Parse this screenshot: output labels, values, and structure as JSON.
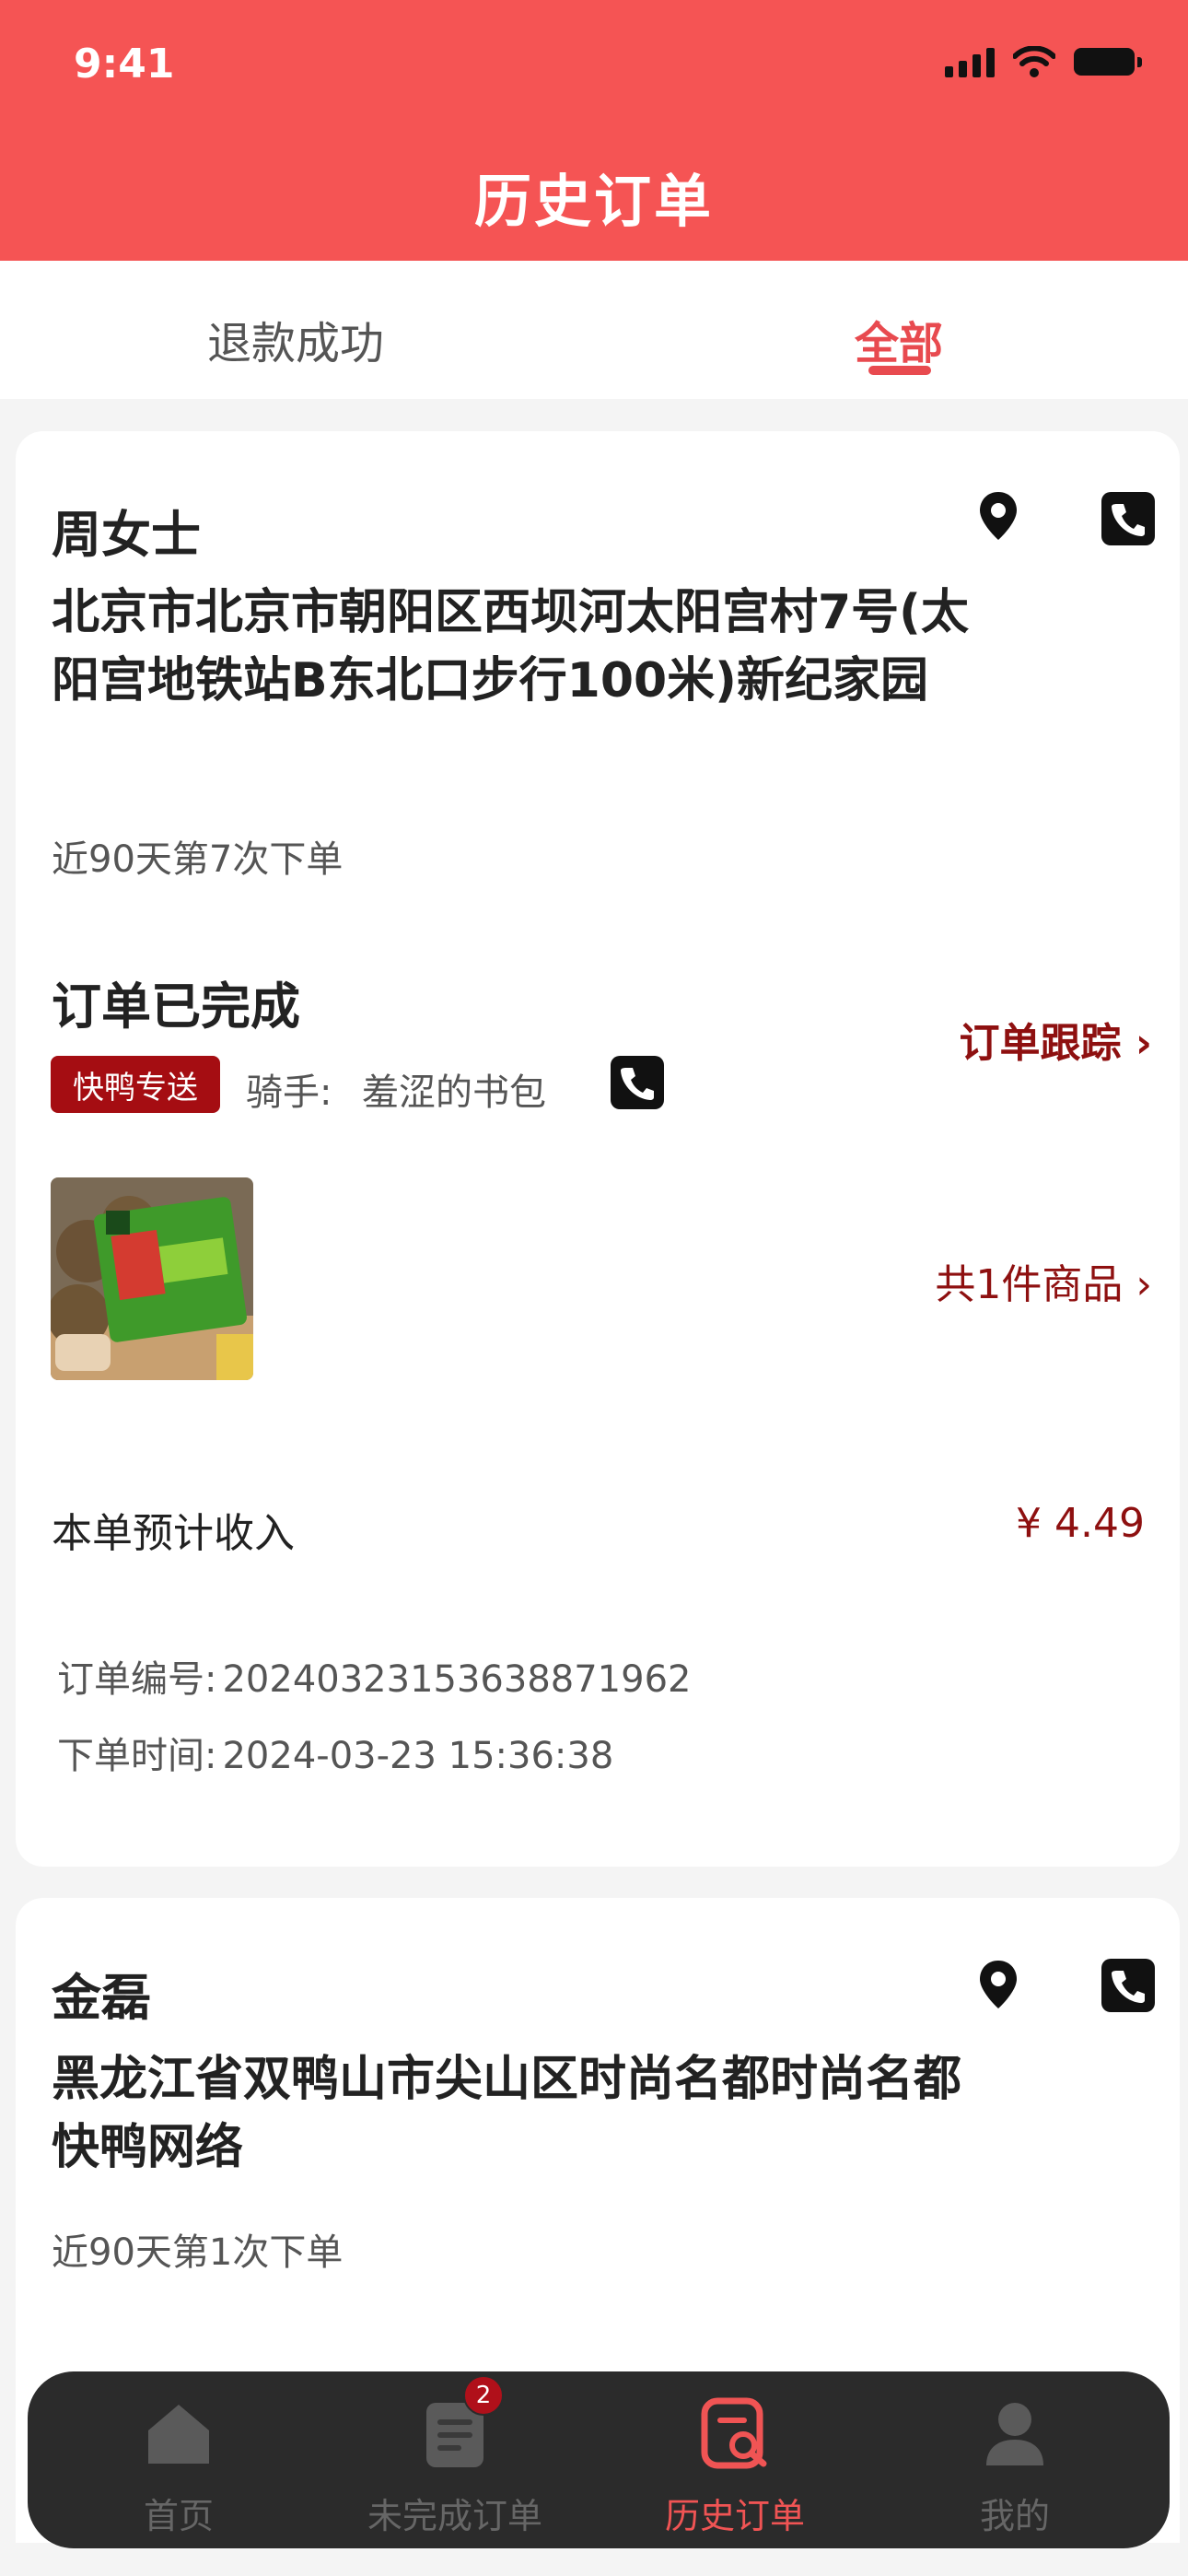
{
  "status_bar": {
    "time": "9:41"
  },
  "header": {
    "title": "历史订单"
  },
  "tabs": [
    {
      "label": "退款成功",
      "active": false
    },
    {
      "label": "全部",
      "active": true
    }
  ],
  "orders": [
    {
      "customer_name": "周女士",
      "address": "北京市北京市朝阳区西坝河太阳宫村7号(太阳宫地铁站B东北口步行100米)新纪家园",
      "order_times": "近90天第7次下单",
      "status": "订单已完成",
      "track_label": "订单跟踪",
      "delivery_badge": "快鸭专送",
      "rider_label": "骑手:",
      "rider_name": "羞涩的书包",
      "items_count": "共1件商品",
      "income_label": "本单预计收入",
      "income_value": "¥ 4.49",
      "order_no_label": "订单编号:",
      "order_no": "20240323153638871962",
      "order_time_label": "下单时间:",
      "order_time": "2024-03-23 15:36:38"
    },
    {
      "customer_name": "金磊",
      "address": "黑龙江省双鸭山市尖山区时尚名都时尚名都快鸭网络",
      "order_times": "近90天第1次下单"
    }
  ],
  "bottom_nav": [
    {
      "label": "首页",
      "icon": "home-icon",
      "active": false
    },
    {
      "label": "未完成订单",
      "icon": "clipboard-icon",
      "active": false,
      "badge": "2"
    },
    {
      "label": "历史订单",
      "icon": "history-search-icon",
      "active": true
    },
    {
      "label": "我的",
      "icon": "user-icon",
      "active": false
    }
  ],
  "colors": {
    "header": "#f55454",
    "accent": "#e84a4f",
    "dark_red": "#8e1010",
    "badge": "#a50d12"
  }
}
